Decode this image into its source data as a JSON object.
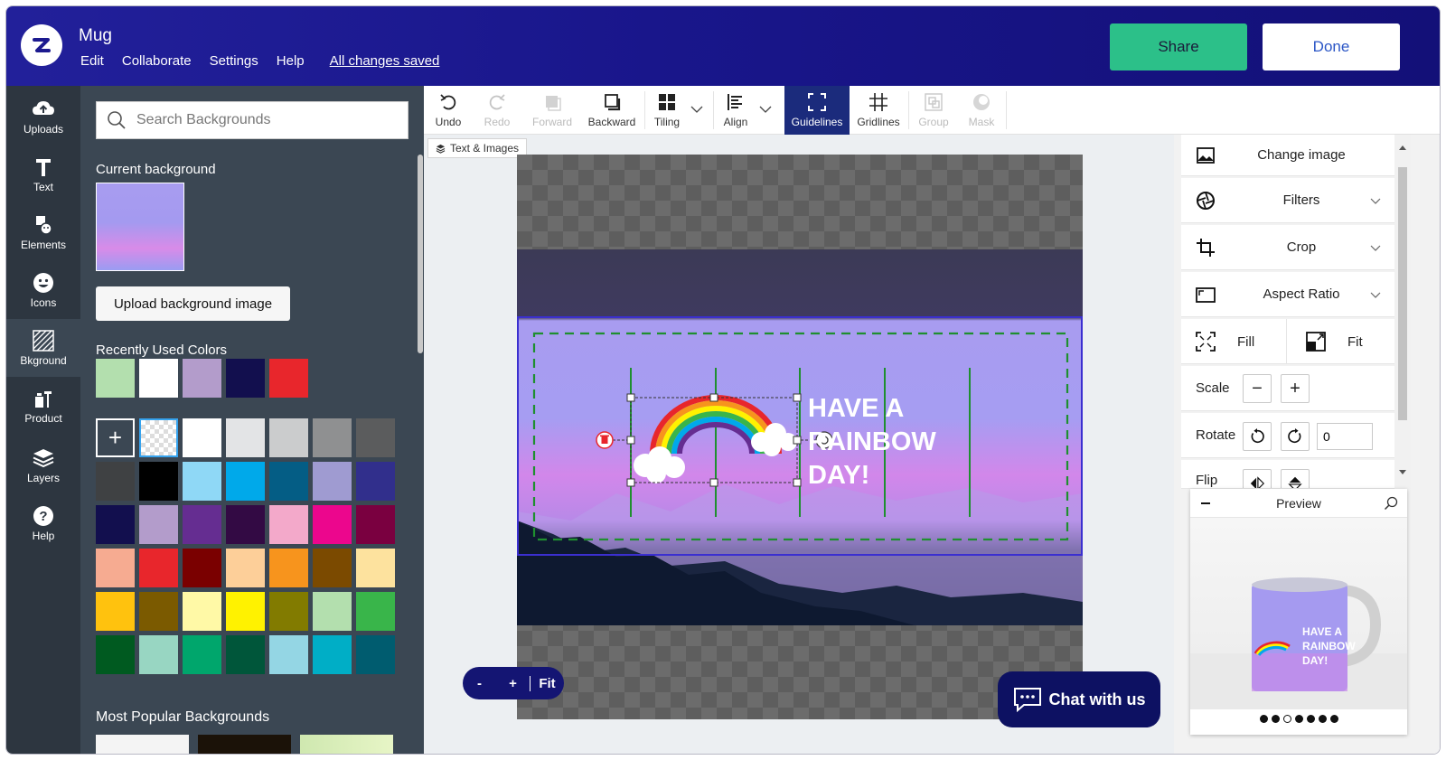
{
  "header": {
    "doc_title": "Mug",
    "menu": [
      "Edit",
      "Collaborate",
      "Settings",
      "Help"
    ],
    "saved_status": "All changes saved",
    "share_label": "Share",
    "done_label": "Done"
  },
  "nav": {
    "items": [
      {
        "label": "Uploads",
        "icon": "upload-cloud-icon"
      },
      {
        "label": "Text",
        "icon": "text-t-icon"
      },
      {
        "label": "Elements",
        "icon": "elements-icon"
      },
      {
        "label": "Icons",
        "icon": "smiley-icon"
      },
      {
        "label": "Bkground",
        "icon": "background-hatch-icon"
      },
      {
        "label": "Product",
        "icon": "product-icon"
      },
      {
        "label": "Layers",
        "icon": "layers-icon"
      },
      {
        "label": "Help",
        "icon": "help-icon"
      }
    ],
    "active": "Bkground"
  },
  "left_panel": {
    "search_placeholder": "Search Backgrounds",
    "current_background_label": "Current background",
    "upload_button": "Upload background image",
    "recent_colors_label": "Recently Used Colors",
    "recent_colors": [
      "#b3dfae",
      "#ffffff",
      "#b39ccb",
      "#120f4e",
      "#e8262c"
    ],
    "add_color_symbol": "+",
    "palette": [
      "#ffffff",
      "#e3e4e6",
      "#cbcccd",
      "#8f9091",
      "#5b5c5d",
      "#3f4143",
      "#000000",
      "#8fd8f6",
      "#00a9ea",
      "#045d85",
      "#9f9bd1",
      "#312f8c",
      "#120f4e",
      "#b39ccb",
      "#652d91",
      "#330a44",
      "#f3a9ca",
      "#ec068d",
      "#7a0040",
      "#f6ab91",
      "#e8262c",
      "#7a0000",
      "#fdcf99",
      "#f7941d",
      "#7b4a00",
      "#fde29e",
      "#ffc20e",
      "#7b5a00",
      "#fff9a6",
      "#fff200",
      "#827b00",
      "#b3dfae",
      "#39b54a",
      "#005a20",
      "#98d6c2",
      "#00a66c",
      "#00563a",
      "#94d6e4",
      "#00aec6",
      "#005c6f"
    ],
    "most_popular_label": "Most Popular Backgrounds"
  },
  "toolbar": {
    "tools": [
      {
        "label": "Undo",
        "icon": "undo-icon",
        "state": "enabled"
      },
      {
        "label": "Redo",
        "icon": "redo-icon",
        "state": "disabled"
      },
      {
        "label": "Forward",
        "icon": "bring-forward-icon",
        "state": "disabled"
      },
      {
        "label": "Backward",
        "icon": "send-backward-icon",
        "state": "enabled"
      },
      {
        "label": "Tiling",
        "icon": "tiling-icon",
        "state": "enabled"
      },
      {
        "label": "Align",
        "icon": "align-icon",
        "state": "enabled"
      },
      {
        "label": "Guidelines",
        "icon": "guidelines-icon",
        "state": "active"
      },
      {
        "label": "Gridlines",
        "icon": "gridlines-icon",
        "state": "enabled"
      },
      {
        "label": "Group",
        "icon": "group-icon",
        "state": "disabled"
      },
      {
        "label": "Mask",
        "icon": "mask-icon",
        "state": "disabled"
      }
    ]
  },
  "canvas": {
    "layer_tab": "Text & Images",
    "design_text": [
      "HAVE A",
      "RAINBOW",
      "DAY!"
    ],
    "zoom_out": "-",
    "zoom_in": "+",
    "zoom_fit": "Fit",
    "chat_label": "Chat with us"
  },
  "properties": {
    "change_image": "Change image",
    "filters": "Filters",
    "crop": "Crop",
    "aspect_ratio": "Aspect Ratio",
    "fill": "Fill",
    "fit": "Fit",
    "scale_label": "Scale",
    "scale_minus": "−",
    "scale_plus": "+",
    "rotate_label": "Rotate",
    "rotate_value": "0",
    "flip_label": "Flip",
    "preview_label": "Preview",
    "preview_text": [
      "HAVE A",
      "RAINBOW",
      "DAY!"
    ],
    "preview_dots": 7,
    "preview_active_dot": 3
  },
  "colors": {
    "header_bg": "#1c1a8f",
    "share_green": "#2cc089",
    "nav_bg": "#2d3640",
    "panel_bg": "#3b4753",
    "guide_green": "#1f8f2f",
    "accent_navy": "#1b2b7c"
  }
}
